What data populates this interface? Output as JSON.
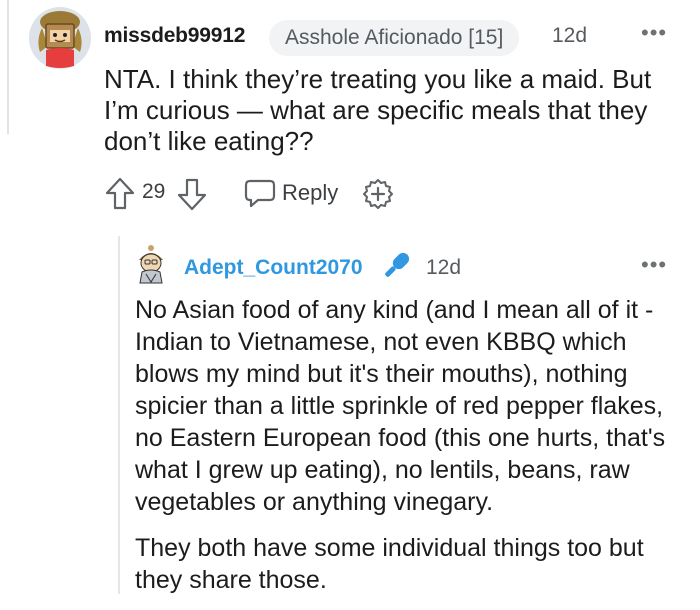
{
  "comment": {
    "username": "missdeb99912",
    "flair": "Asshole Aficionado [15]",
    "age": "12d",
    "more_label": "•••",
    "body": "NTA. I think they’re treating you like a maid. But I’m curious — what are specific meals that they don’t like eating??",
    "score": "29",
    "reply_label": "Reply"
  },
  "reply": {
    "username": "Adept_Count2070",
    "age": "12d",
    "more_label": "•••",
    "paragraphs": [
      "No Asian food of any kind (and I mean all of it - Indian to Vietnamese, not even KBBQ which blows my mind but it's their mouths), nothing spicier than a little sprinkle of red pepper flakes, no Eastern European food (this one hurts, that's what I grew up eating), no lentils, beans, raw vegetables or anything vinegary.",
      "They both have some individual things too but they share those."
    ]
  },
  "icons": {
    "upvote": "upvote-arrow-icon",
    "downvote": "downvote-arrow-icon",
    "reply": "speech-bubble-icon",
    "award": "award-plus-icon",
    "mic": "microphone-icon"
  },
  "colors": {
    "reply_username": "#2f98e0",
    "mic": "#2f98e0",
    "flair_bg": "#f2f3f5"
  }
}
